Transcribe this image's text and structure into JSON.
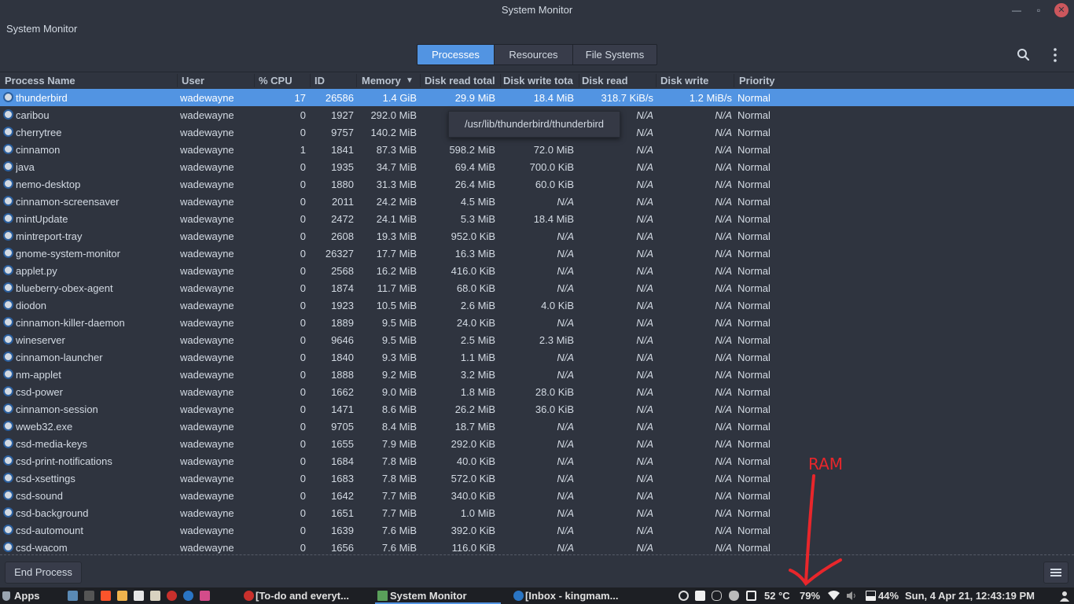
{
  "window": {
    "title": "System Monitor",
    "menu_label": "System Monitor",
    "controls": {
      "minimize": "—",
      "maximize": "▫",
      "close": "✕"
    }
  },
  "toolbar": {
    "tabs": [
      {
        "label": "Processes",
        "active": true
      },
      {
        "label": "Resources",
        "active": false
      },
      {
        "label": "File Systems",
        "active": false
      }
    ],
    "icons": [
      "search-icon",
      "kebab-menu-icon"
    ]
  },
  "table": {
    "columns": [
      "Process Name",
      "User",
      "% CPU",
      "ID",
      "Memory",
      "Disk read total",
      "Disk write tota",
      "Disk read",
      "Disk write",
      "Priority"
    ],
    "sort_indicator": "▼",
    "rows": [
      [
        "thunderbird",
        "wadewayne",
        "17",
        "26586",
        "1.4 GiB",
        "29.9 MiB",
        "18.4 MiB",
        "318.7 KiB/s",
        "1.2 MiB/s",
        "Normal"
      ],
      [
        "caribou",
        "wadewayne",
        "0",
        "1927",
        "292.0 MiB",
        "",
        "",
        "N/A",
        "N/A",
        "Normal"
      ],
      [
        "cherrytree",
        "wadewayne",
        "0",
        "9757",
        "140.2 MiB",
        "",
        "",
        "N/A",
        "N/A",
        "Normal"
      ],
      [
        "cinnamon",
        "wadewayne",
        "1",
        "1841",
        "87.3 MiB",
        "598.2 MiB",
        "72.0 MiB",
        "N/A",
        "N/A",
        "Normal"
      ],
      [
        "java",
        "wadewayne",
        "0",
        "1935",
        "34.7 MiB",
        "69.4 MiB",
        "700.0 KiB",
        "N/A",
        "N/A",
        "Normal"
      ],
      [
        "nemo-desktop",
        "wadewayne",
        "0",
        "1880",
        "31.3 MiB",
        "26.4 MiB",
        "60.0 KiB",
        "N/A",
        "N/A",
        "Normal"
      ],
      [
        "cinnamon-screensaver",
        "wadewayne",
        "0",
        "2011",
        "24.2 MiB",
        "4.5 MiB",
        "N/A",
        "N/A",
        "N/A",
        "Normal"
      ],
      [
        "mintUpdate",
        "wadewayne",
        "0",
        "2472",
        "24.1 MiB",
        "5.3 MiB",
        "18.4 MiB",
        "N/A",
        "N/A",
        "Normal"
      ],
      [
        "mintreport-tray",
        "wadewayne",
        "0",
        "2608",
        "19.3 MiB",
        "952.0 KiB",
        "N/A",
        "N/A",
        "N/A",
        "Normal"
      ],
      [
        "gnome-system-monitor",
        "wadewayne",
        "0",
        "26327",
        "17.7 MiB",
        "16.3 MiB",
        "N/A",
        "N/A",
        "N/A",
        "Normal"
      ],
      [
        "applet.py",
        "wadewayne",
        "0",
        "2568",
        "16.2 MiB",
        "416.0 KiB",
        "N/A",
        "N/A",
        "N/A",
        "Normal"
      ],
      [
        "blueberry-obex-agent",
        "wadewayne",
        "0",
        "1874",
        "11.7 MiB",
        "68.0 KiB",
        "N/A",
        "N/A",
        "N/A",
        "Normal"
      ],
      [
        "diodon",
        "wadewayne",
        "0",
        "1923",
        "10.5 MiB",
        "2.6 MiB",
        "4.0 KiB",
        "N/A",
        "N/A",
        "Normal"
      ],
      [
        "cinnamon-killer-daemon",
        "wadewayne",
        "0",
        "1889",
        "9.5 MiB",
        "24.0 KiB",
        "N/A",
        "N/A",
        "N/A",
        "Normal"
      ],
      [
        "wineserver",
        "wadewayne",
        "0",
        "9646",
        "9.5 MiB",
        "2.5 MiB",
        "2.3 MiB",
        "N/A",
        "N/A",
        "Normal"
      ],
      [
        "cinnamon-launcher",
        "wadewayne",
        "0",
        "1840",
        "9.3 MiB",
        "1.1 MiB",
        "N/A",
        "N/A",
        "N/A",
        "Normal"
      ],
      [
        "nm-applet",
        "wadewayne",
        "0",
        "1888",
        "9.2 MiB",
        "3.2 MiB",
        "N/A",
        "N/A",
        "N/A",
        "Normal"
      ],
      [
        "csd-power",
        "wadewayne",
        "0",
        "1662",
        "9.0 MiB",
        "1.8 MiB",
        "28.0 KiB",
        "N/A",
        "N/A",
        "Normal"
      ],
      [
        "cinnamon-session",
        "wadewayne",
        "0",
        "1471",
        "8.6 MiB",
        "26.2 MiB",
        "36.0 KiB",
        "N/A",
        "N/A",
        "Normal"
      ],
      [
        "wweb32.exe",
        "wadewayne",
        "0",
        "9705",
        "8.4 MiB",
        "18.7 MiB",
        "N/A",
        "N/A",
        "N/A",
        "Normal"
      ],
      [
        "csd-media-keys",
        "wadewayne",
        "0",
        "1655",
        "7.9 MiB",
        "292.0 KiB",
        "N/A",
        "N/A",
        "N/A",
        "Normal"
      ],
      [
        "csd-print-notifications",
        "wadewayne",
        "0",
        "1684",
        "7.8 MiB",
        "40.0 KiB",
        "N/A",
        "N/A",
        "N/A",
        "Normal"
      ],
      [
        "csd-xsettings",
        "wadewayne",
        "0",
        "1683",
        "7.8 MiB",
        "572.0 KiB",
        "N/A",
        "N/A",
        "N/A",
        "Normal"
      ],
      [
        "csd-sound",
        "wadewayne",
        "0",
        "1642",
        "7.7 MiB",
        "340.0 KiB",
        "N/A",
        "N/A",
        "N/A",
        "Normal"
      ],
      [
        "csd-background",
        "wadewayne",
        "0",
        "1651",
        "7.7 MiB",
        "1.0 MiB",
        "N/A",
        "N/A",
        "N/A",
        "Normal"
      ],
      [
        "csd-automount",
        "wadewayne",
        "0",
        "1639",
        "7.6 MiB",
        "392.0 KiB",
        "N/A",
        "N/A",
        "N/A",
        "Normal"
      ],
      [
        "csd-wacom",
        "wadewayne",
        "0",
        "1656",
        "7.6 MiB",
        "116.0 KiB",
        "N/A",
        "N/A",
        "N/A",
        "Normal"
      ]
    ],
    "selected_index": 0
  },
  "tooltip": {
    "text": "/usr/lib/thunderbird/thunderbird"
  },
  "bottom": {
    "end_process_label": "End Process"
  },
  "taskbar": {
    "menu_label": "Apps",
    "windows": [
      {
        "label": "[To-do and everyt...",
        "icon": "cherrytree-icon"
      },
      {
        "label": "System Monitor",
        "icon": "system-monitor-icon",
        "active": true
      },
      {
        "label": "[Inbox - kingmam...",
        "icon": "thunderbird-icon"
      }
    ],
    "temperature": "52 °C",
    "ram_percent": "79%",
    "battery": "44%",
    "clock": "Sun,  4 Apr 21, 12:43:19 PM"
  },
  "annotation": {
    "text": "RAM",
    "color": "#e8262b"
  },
  "colors": {
    "accent": "#5294e2",
    "background": "#2f343f",
    "taskbar": "#1d1f24"
  }
}
